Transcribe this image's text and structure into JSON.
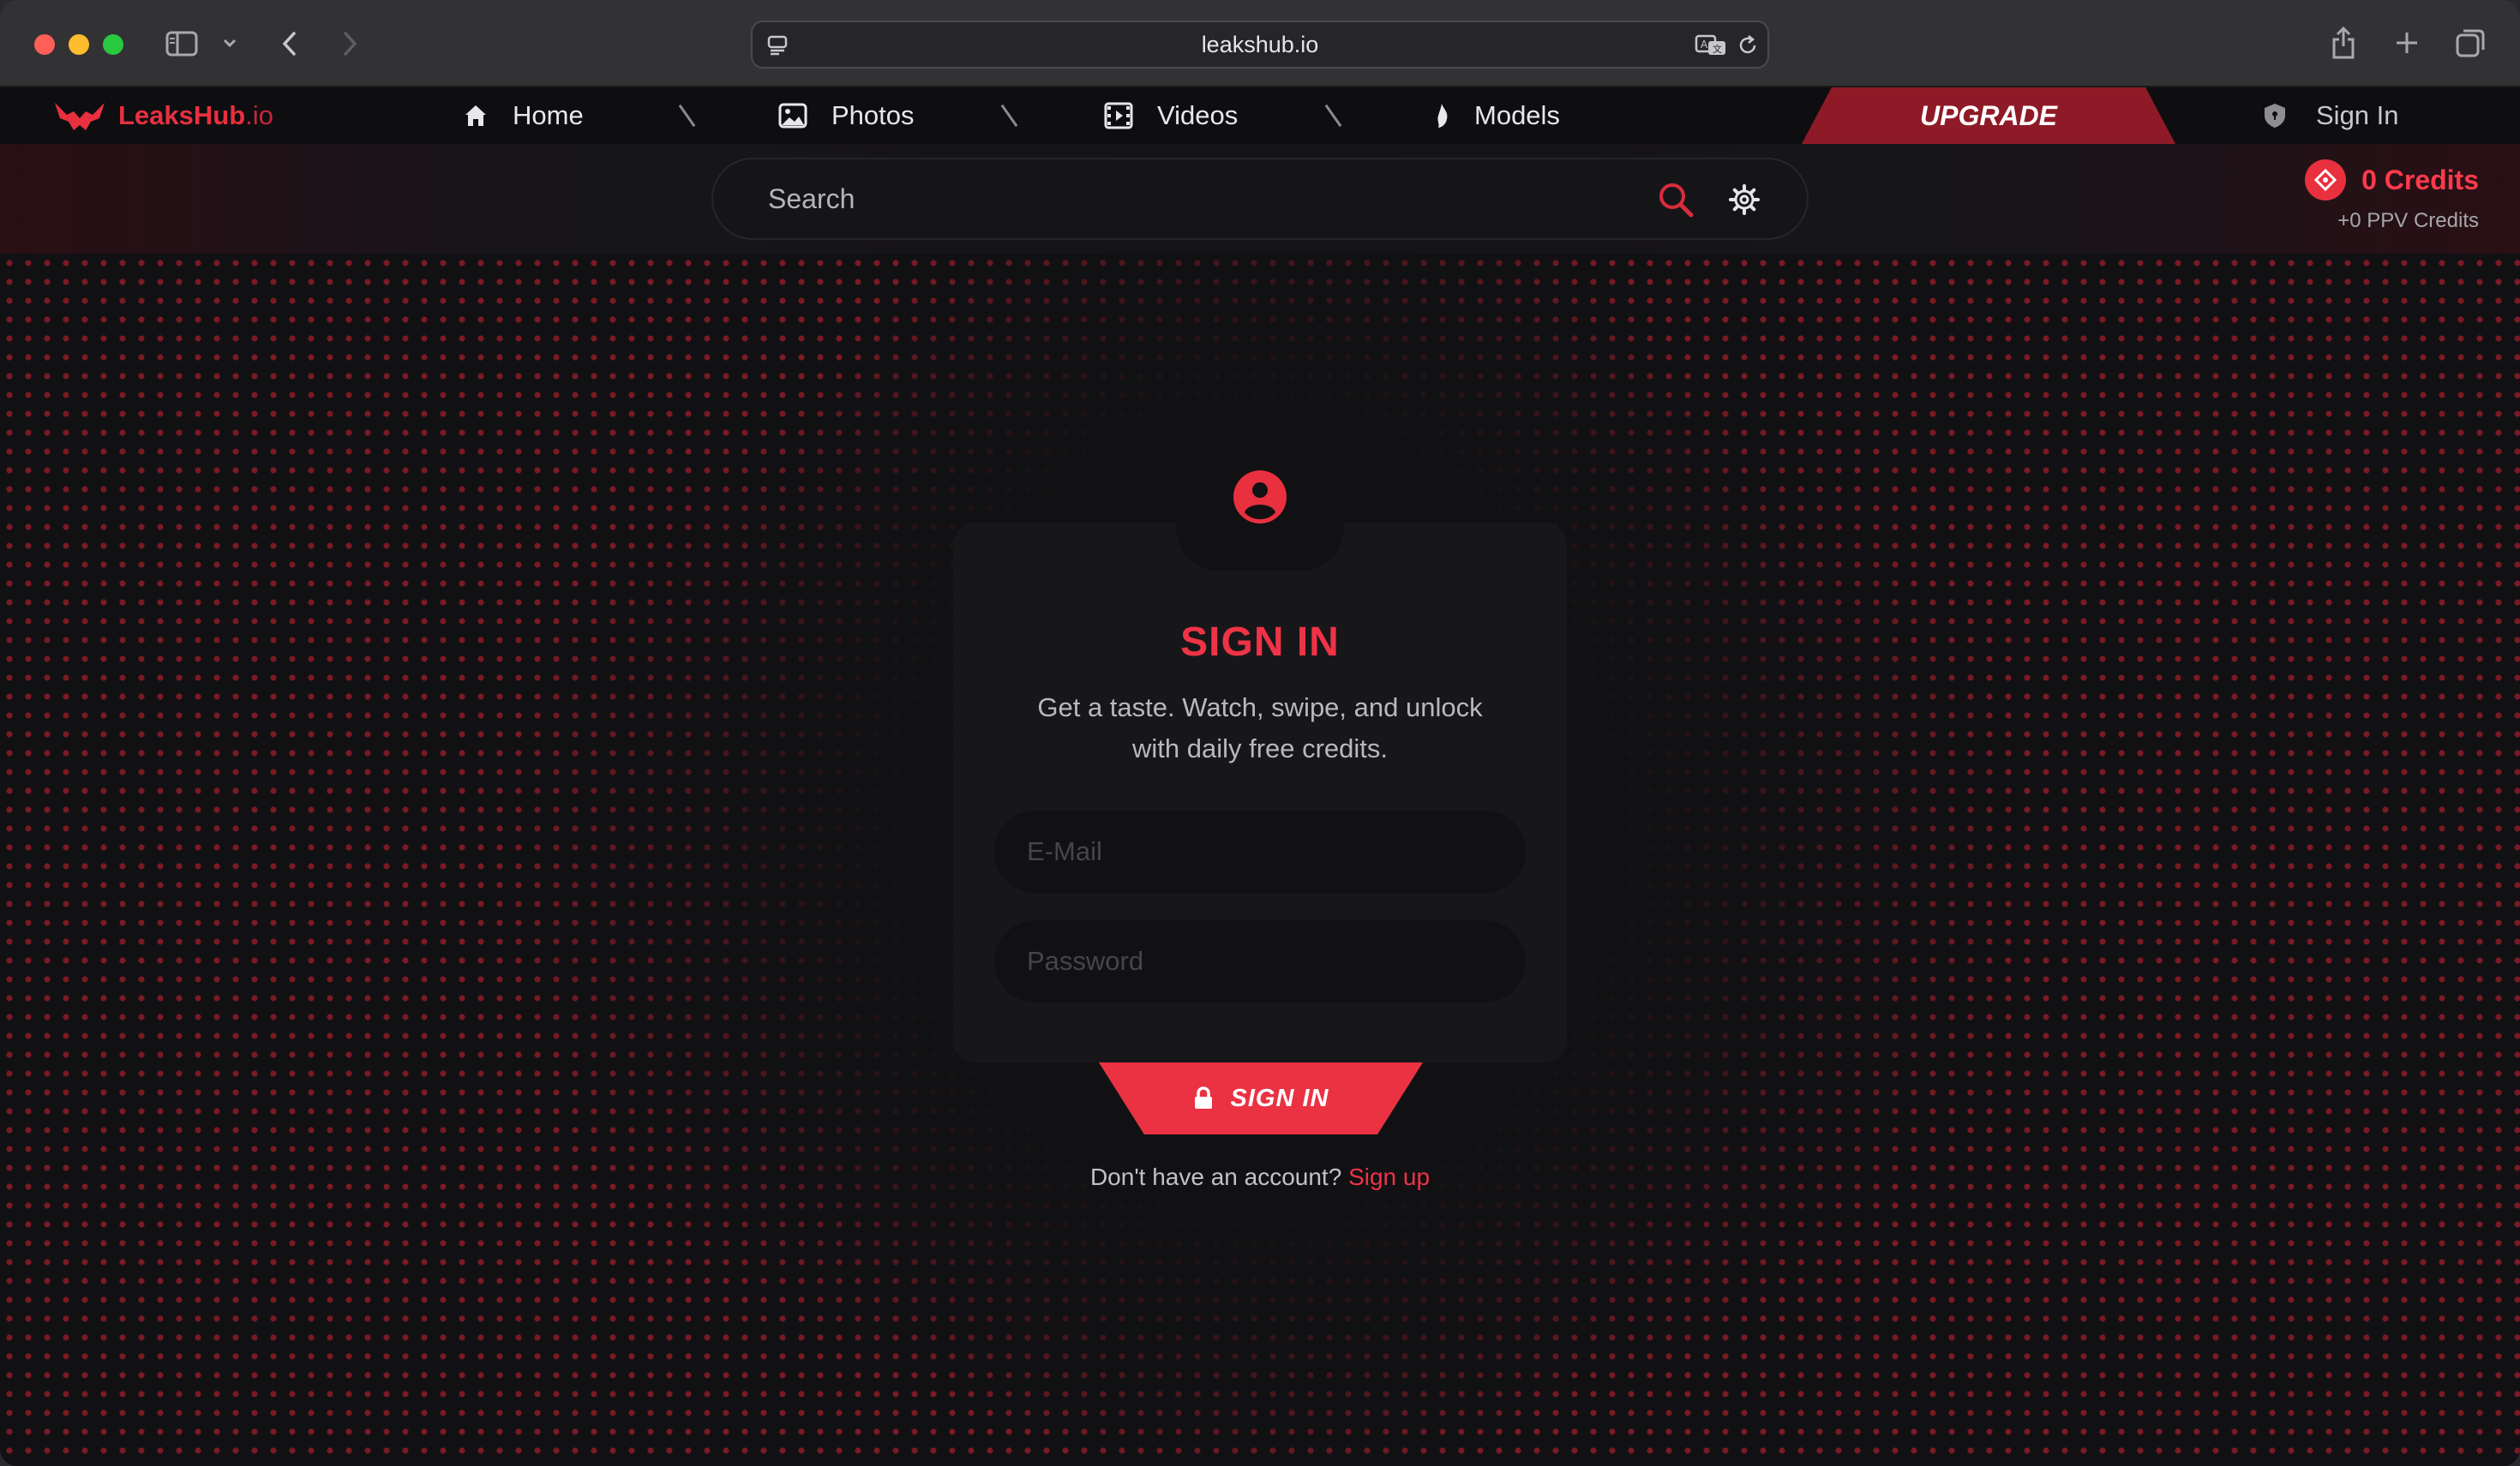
{
  "browser": {
    "url": "leakshub.io"
  },
  "site": {
    "logo_name": "LeaksHub",
    "logo_tld": ".io",
    "nav": [
      {
        "label": "Home",
        "icon": "home-icon"
      },
      {
        "label": "Photos",
        "icon": "image-icon"
      },
      {
        "label": "Videos",
        "icon": "film-icon"
      },
      {
        "label": "Models",
        "icon": "flame-icon"
      }
    ],
    "upgrade_label": "UPGRADE",
    "signin_label": "Sign In",
    "accent_color": "#e8303f"
  },
  "search": {
    "placeholder": "Search"
  },
  "credits": {
    "main": "0 Credits",
    "sub": "+0 PPV Credits"
  },
  "login": {
    "title": "SIGN IN",
    "subtitle": "Get a taste. Watch, swipe, and unlock with daily free credits.",
    "email_placeholder": "E-Mail",
    "password_placeholder": "Password",
    "button_label": "SIGN IN",
    "no_account_text": "Don't have an account?",
    "signup_link": "Sign up"
  }
}
